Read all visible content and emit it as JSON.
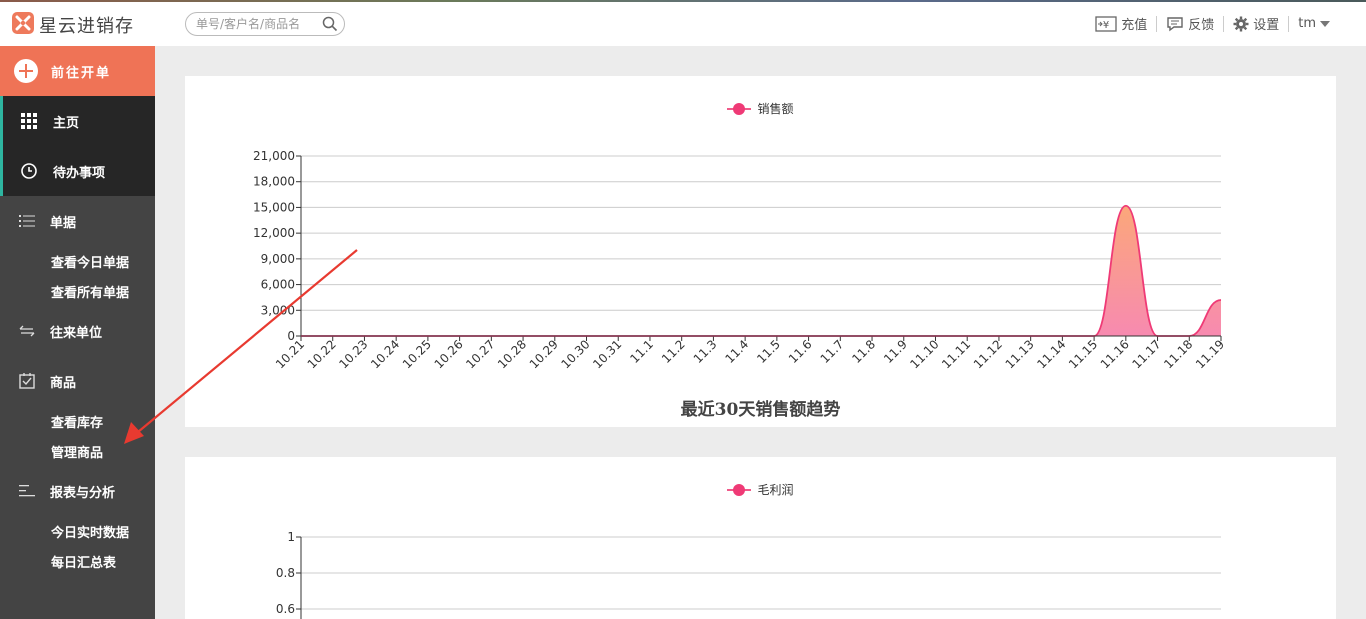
{
  "app": {
    "name": "星云进销存",
    "search_placeholder": "单号/客户名/商品名",
    "toolbar": {
      "recharge": "充值",
      "feedback": "反馈",
      "settings": "设置",
      "user": "tm"
    }
  },
  "sidebar": {
    "new_order": "前往开单",
    "home": "主页",
    "todo": "待办事项",
    "groups": [
      {
        "label": "单据",
        "icon": "list-icon",
        "items": [
          "查看今日单据",
          "查看所有单据"
        ]
      },
      {
        "label": "往来单位",
        "icon": "exchange-icon",
        "items": []
      },
      {
        "label": "商品",
        "icon": "checkbox-icon",
        "items": [
          "查看库存",
          "管理商品"
        ]
      },
      {
        "label": "报表与分析",
        "icon": "report-icon",
        "items": [
          "今日实时数据",
          "每日汇总表"
        ]
      }
    ]
  },
  "colors": {
    "accent": "#ef7356",
    "series": "#ef3a76",
    "area": "#f78ab0"
  },
  "chart_data": [
    {
      "type": "area",
      "title": "最近30天销售额趋势",
      "legend": [
        "销售额"
      ],
      "legend_position": "top-center",
      "grid": true,
      "categories": [
        "10.21",
        "10.22",
        "10.23",
        "10.24",
        "10.25",
        "10.26",
        "10.27",
        "10.28",
        "10.29",
        "10.30",
        "10.31",
        "11.1",
        "11.2",
        "11.3",
        "11.4",
        "11.5",
        "11.6",
        "11.7",
        "11.8",
        "11.9",
        "11.10",
        "11.11",
        "11.12",
        "11.13",
        "11.14",
        "11.15",
        "11.16",
        "11.17",
        "11.18",
        "11.19"
      ],
      "series": [
        {
          "name": "销售额",
          "values": [
            0,
            0,
            0,
            0,
            0,
            0,
            0,
            0,
            0,
            0,
            0,
            0,
            0,
            0,
            0,
            0,
            0,
            0,
            0,
            0,
            0,
            0,
            0,
            0,
            0,
            0,
            15200,
            0,
            0,
            4200
          ]
        }
      ],
      "yticks": [
        "0",
        "3,000",
        "6,000",
        "9,000",
        "12,000",
        "15,000",
        "18,000",
        "21,000"
      ],
      "ylim": [
        0,
        21000
      ]
    },
    {
      "type": "area",
      "title": "",
      "legend": [
        "毛利润"
      ],
      "legend_position": "top-center",
      "grid": true,
      "series": [
        {
          "name": "毛利润",
          "values": []
        }
      ],
      "yticks": [
        "0.6",
        "0.8",
        "1"
      ],
      "ylim": [
        0,
        1
      ]
    }
  ]
}
